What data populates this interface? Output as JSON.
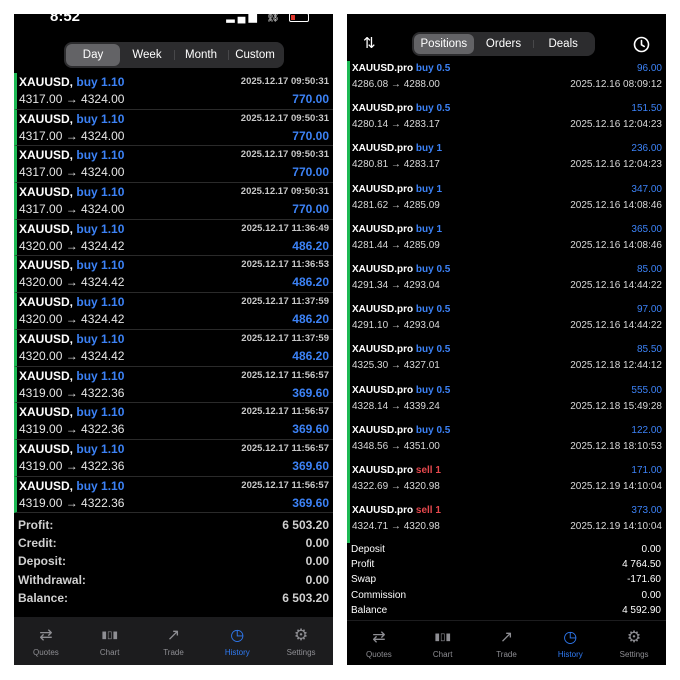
{
  "left": {
    "status": {
      "time": "8:52"
    },
    "period_tabs": [
      {
        "label": "Day",
        "active": true
      },
      {
        "label": "Week",
        "active": false
      },
      {
        "label": "Month",
        "active": false
      },
      {
        "label": "Custom",
        "active": false
      }
    ],
    "deals": [
      {
        "symbol": "XAUUSD,",
        "action": "buy 1.10",
        "datetime": "2025.12.17 09:50:31",
        "prices": "4317.00 → 4324.00",
        "profit": "770.00"
      },
      {
        "symbol": "XAUUSD,",
        "action": "buy 1.10",
        "datetime": "2025.12.17 09:50:31",
        "prices": "4317.00 → 4324.00",
        "profit": "770.00"
      },
      {
        "symbol": "XAUUSD,",
        "action": "buy 1.10",
        "datetime": "2025.12.17 09:50:31",
        "prices": "4317.00 → 4324.00",
        "profit": "770.00"
      },
      {
        "symbol": "XAUUSD,",
        "action": "buy 1.10",
        "datetime": "2025.12.17 09:50:31",
        "prices": "4317.00 → 4324.00",
        "profit": "770.00"
      },
      {
        "symbol": "XAUUSD,",
        "action": "buy 1.10",
        "datetime": "2025.12.17 11:36:49",
        "prices": "4320.00 → 4324.42",
        "profit": "486.20"
      },
      {
        "symbol": "XAUUSD,",
        "action": "buy 1.10",
        "datetime": "2025.12.17 11:36:53",
        "prices": "4320.00 → 4324.42",
        "profit": "486.20"
      },
      {
        "symbol": "XAUUSD,",
        "action": "buy 1.10",
        "datetime": "2025.12.17 11:37:59",
        "prices": "4320.00 → 4324.42",
        "profit": "486.20"
      },
      {
        "symbol": "XAUUSD,",
        "action": "buy 1.10",
        "datetime": "2025.12.17 11:37:59",
        "prices": "4320.00 → 4324.42",
        "profit": "486.20"
      },
      {
        "symbol": "XAUUSD,",
        "action": "buy 1.10",
        "datetime": "2025.12.17 11:56:57",
        "prices": "4319.00 → 4322.36",
        "profit": "369.60"
      },
      {
        "symbol": "XAUUSD,",
        "action": "buy 1.10",
        "datetime": "2025.12.17 11:56:57",
        "prices": "4319.00 → 4322.36",
        "profit": "369.60"
      },
      {
        "symbol": "XAUUSD,",
        "action": "buy 1.10",
        "datetime": "2025.12.17 11:56:57",
        "prices": "4319.00 → 4322.36",
        "profit": "369.60"
      },
      {
        "symbol": "XAUUSD,",
        "action": "buy 1.10",
        "datetime": "2025.12.17 11:56:57",
        "prices": "4319.00 → 4322.36",
        "profit": "369.60"
      }
    ],
    "summary": [
      {
        "label": "Profit:",
        "value": "6 503.20"
      },
      {
        "label": "Credit:",
        "value": "0.00"
      },
      {
        "label": "Deposit:",
        "value": "0.00"
      },
      {
        "label": "Withdrawal:",
        "value": "0.00"
      },
      {
        "label": "Balance:",
        "value": "6 503.20"
      }
    ],
    "tabbar": [
      {
        "label": "Quotes",
        "icon": "quotes-icon",
        "active": false
      },
      {
        "label": "Chart",
        "icon": "chart-icon",
        "active": false
      },
      {
        "label": "Trade",
        "icon": "trade-icon",
        "active": false
      },
      {
        "label": "History",
        "icon": "history-icon",
        "active": true
      },
      {
        "label": "Settings",
        "icon": "settings-icon",
        "active": false
      }
    ]
  },
  "right": {
    "mode_tabs": [
      {
        "label": "Positions",
        "active": true
      },
      {
        "label": "Orders",
        "active": false
      },
      {
        "label": "Deals",
        "active": false
      }
    ],
    "header_icons": {
      "sort": "sort-icon",
      "clock": "clock-icon"
    },
    "deals": [
      {
        "symbol": "XAUUSD.pro",
        "action": "buy 0.5",
        "side": "buy",
        "prices": "4286.08 → 4288.00",
        "profit": "96.00",
        "datetime": "2025.12.16 08:09:12"
      },
      {
        "symbol": "XAUUSD.pro",
        "action": "buy 0.5",
        "side": "buy",
        "prices": "4280.14 → 4283.17",
        "profit": "151.50",
        "datetime": "2025.12.16 12:04:23"
      },
      {
        "symbol": "XAUUSD.pro",
        "action": "buy 1",
        "side": "buy",
        "prices": "4280.81 → 4283.17",
        "profit": "236.00",
        "datetime": "2025.12.16 12:04:23"
      },
      {
        "symbol": "XAUUSD.pro",
        "action": "buy 1",
        "side": "buy",
        "prices": "4281.62 → 4285.09",
        "profit": "347.00",
        "datetime": "2025.12.16 14:08:46"
      },
      {
        "symbol": "XAUUSD.pro",
        "action": "buy 1",
        "side": "buy",
        "prices": "4281.44 → 4285.09",
        "profit": "365.00",
        "datetime": "2025.12.16 14:08:46"
      },
      {
        "symbol": "XAUUSD.pro",
        "action": "buy 0.5",
        "side": "buy",
        "prices": "4291.34 → 4293.04",
        "profit": "85.00",
        "datetime": "2025.12.16 14:44:22"
      },
      {
        "symbol": "XAUUSD.pro",
        "action": "buy 0.5",
        "side": "buy",
        "prices": "4291.10 → 4293.04",
        "profit": "97.00",
        "datetime": "2025.12.16 14:44:22"
      },
      {
        "symbol": "XAUUSD.pro",
        "action": "buy 0.5",
        "side": "buy",
        "prices": "4325.30 → 4327.01",
        "profit": "85.50",
        "datetime": "2025.12.18 12:44:12"
      },
      {
        "symbol": "XAUUSD.pro",
        "action": "buy 0.5",
        "side": "buy",
        "prices": "4328.14 → 4339.24",
        "profit": "555.00",
        "datetime": "2025.12.18 15:49:28"
      },
      {
        "symbol": "XAUUSD.pro",
        "action": "buy 0.5",
        "side": "buy",
        "prices": "4348.56 → 4351.00",
        "profit": "122.00",
        "datetime": "2025.12.18 18:10:53"
      },
      {
        "symbol": "XAUUSD.pro",
        "action": "sell 1",
        "side": "sell",
        "prices": "4322.69 → 4320.98",
        "profit": "171.00",
        "datetime": "2025.12.19 14:10:04"
      },
      {
        "symbol": "XAUUSD.pro",
        "action": "sell 1",
        "side": "sell",
        "prices": "4324.71 → 4320.98",
        "profit": "373.00",
        "datetime": "2025.12.19 14:10:04"
      }
    ],
    "summary": [
      {
        "label": "Deposit",
        "value": "0.00"
      },
      {
        "label": "Profit",
        "value": "4 764.50"
      },
      {
        "label": "Swap",
        "value": "-171.60"
      },
      {
        "label": "Commission",
        "value": "0.00"
      },
      {
        "label": "Balance",
        "value": "4 592.90"
      }
    ],
    "tabbar": [
      {
        "label": "Quotes",
        "icon": "quotes-icon",
        "active": false
      },
      {
        "label": "Chart",
        "icon": "chart-icon",
        "active": false
      },
      {
        "label": "Trade",
        "icon": "trade-icon",
        "active": false
      },
      {
        "label": "History",
        "icon": "history-icon",
        "active": true
      },
      {
        "label": "Settings",
        "icon": "settings-icon",
        "active": false
      }
    ]
  },
  "colors": {
    "accent": "#2f7bf5",
    "buy": "#3c82f6",
    "sell": "#e5484d",
    "profit_bar": "#1db954"
  }
}
